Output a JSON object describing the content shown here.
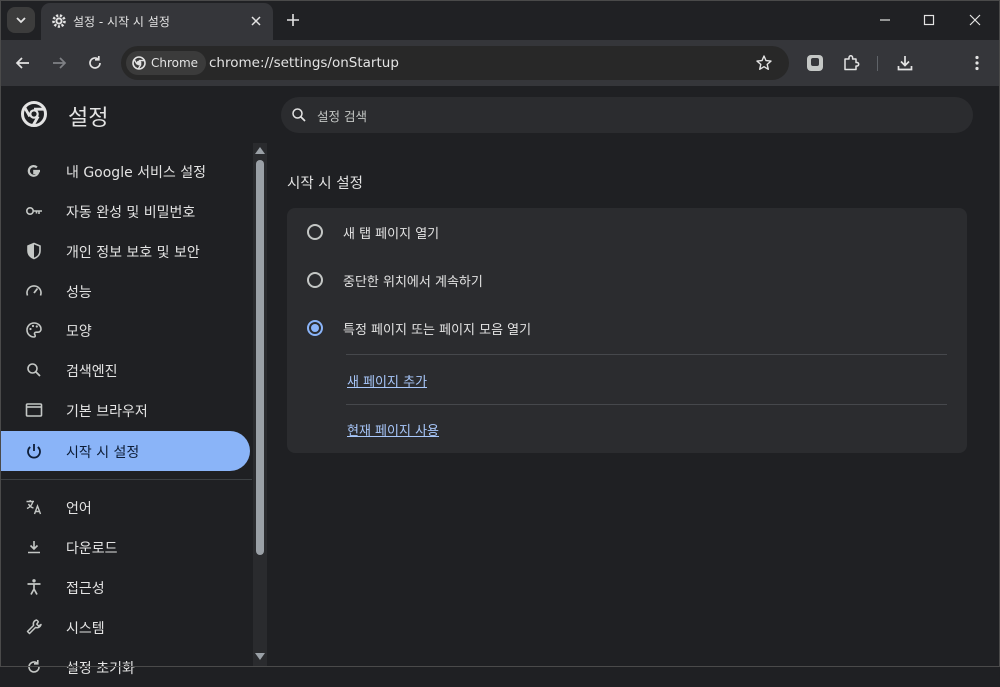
{
  "window": {
    "tab_title": "설정 - 시작 시 설정"
  },
  "omnibox": {
    "chip_label": "Chrome",
    "url": "chrome://settings/onStartup"
  },
  "sidebar": {
    "title": "설정",
    "items": [
      {
        "label": "내 Google 서비스 설정",
        "icon": "google-g-icon"
      },
      {
        "label": "자동 완성 및 비밀번호",
        "icon": "key-icon"
      },
      {
        "label": "개인 정보 보호 및 보안",
        "icon": "shield-icon"
      },
      {
        "label": "성능",
        "icon": "speedometer-icon"
      },
      {
        "label": "모양",
        "icon": "palette-icon"
      },
      {
        "label": "검색엔진",
        "icon": "search-icon"
      },
      {
        "label": "기본 브라우저",
        "icon": "browser-window-icon"
      },
      {
        "label": "시작 시 설정",
        "icon": "power-icon",
        "active": true
      },
      {
        "label": "언어",
        "icon": "translate-icon"
      },
      {
        "label": "다운로드",
        "icon": "download-icon"
      },
      {
        "label": "접근성",
        "icon": "accessibility-icon"
      },
      {
        "label": "시스템",
        "icon": "wrench-icon"
      },
      {
        "label": "설정 초기화",
        "icon": "reset-icon"
      }
    ]
  },
  "search": {
    "placeholder": "설정 검색"
  },
  "startup": {
    "section_title": "시작 시 설정",
    "options": [
      {
        "label": "새 탭 페이지 열기",
        "checked": false
      },
      {
        "label": "중단한 위치에서 계속하기",
        "checked": false
      },
      {
        "label": "특정 페이지 또는 페이지 모음 열기",
        "checked": true
      }
    ],
    "add_page_link": "새 페이지 추가",
    "use_current_link": "현재 페이지 사용"
  },
  "colors": {
    "accent": "#8ab4f8",
    "background": "#1f2023",
    "card": "#2b2c2f"
  }
}
